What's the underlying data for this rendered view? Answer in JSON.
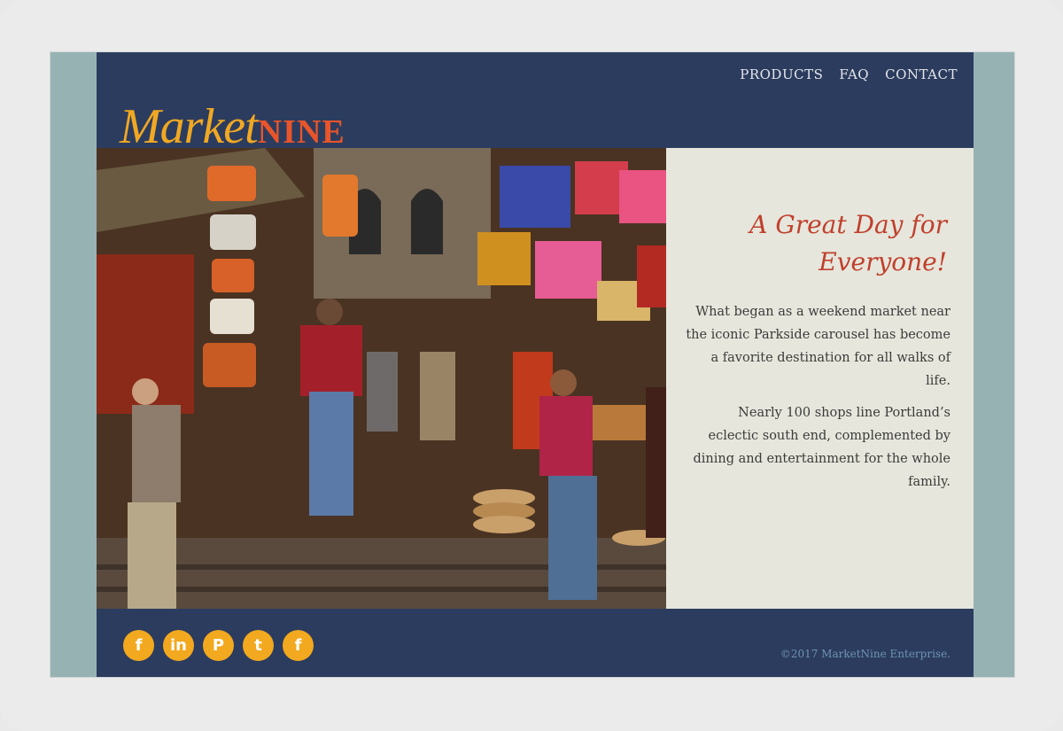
{
  "nav": {
    "products": "PRODUCTS",
    "faq": "FAQ",
    "contact": "CONTACT"
  },
  "logo": {
    "market": "Market",
    "nine": "NINE"
  },
  "hero": {
    "heading": "A Great Day for Everyone!",
    "paragraph1": "What began as a weekend market near the iconic Parkside carousel has become a favorite destination for all walks of life.",
    "paragraph2": "Nearly 100 shops line Portland’s eclectic south end, complemented by dining and entertainment for the whole family."
  },
  "footer": {
    "social": [
      {
        "icon": "facebook-icon",
        "glyph": "f"
      },
      {
        "icon": "linkedin-icon",
        "glyph": "in"
      },
      {
        "icon": "pinterest-icon",
        "glyph": "P"
      },
      {
        "icon": "twitter-icon",
        "glyph": "t"
      },
      {
        "icon": "facebook-icon",
        "glyph": "f"
      }
    ],
    "copyright": "©2017 MarketNine Enterprise."
  },
  "colors": {
    "navy": "#2c3c5e",
    "accent_orange": "#f2a91f",
    "accent_red": "#e8552b",
    "heading_red": "#c0402c",
    "panel_bg": "#e6e6dc",
    "side_teal": "#97b2b3"
  }
}
